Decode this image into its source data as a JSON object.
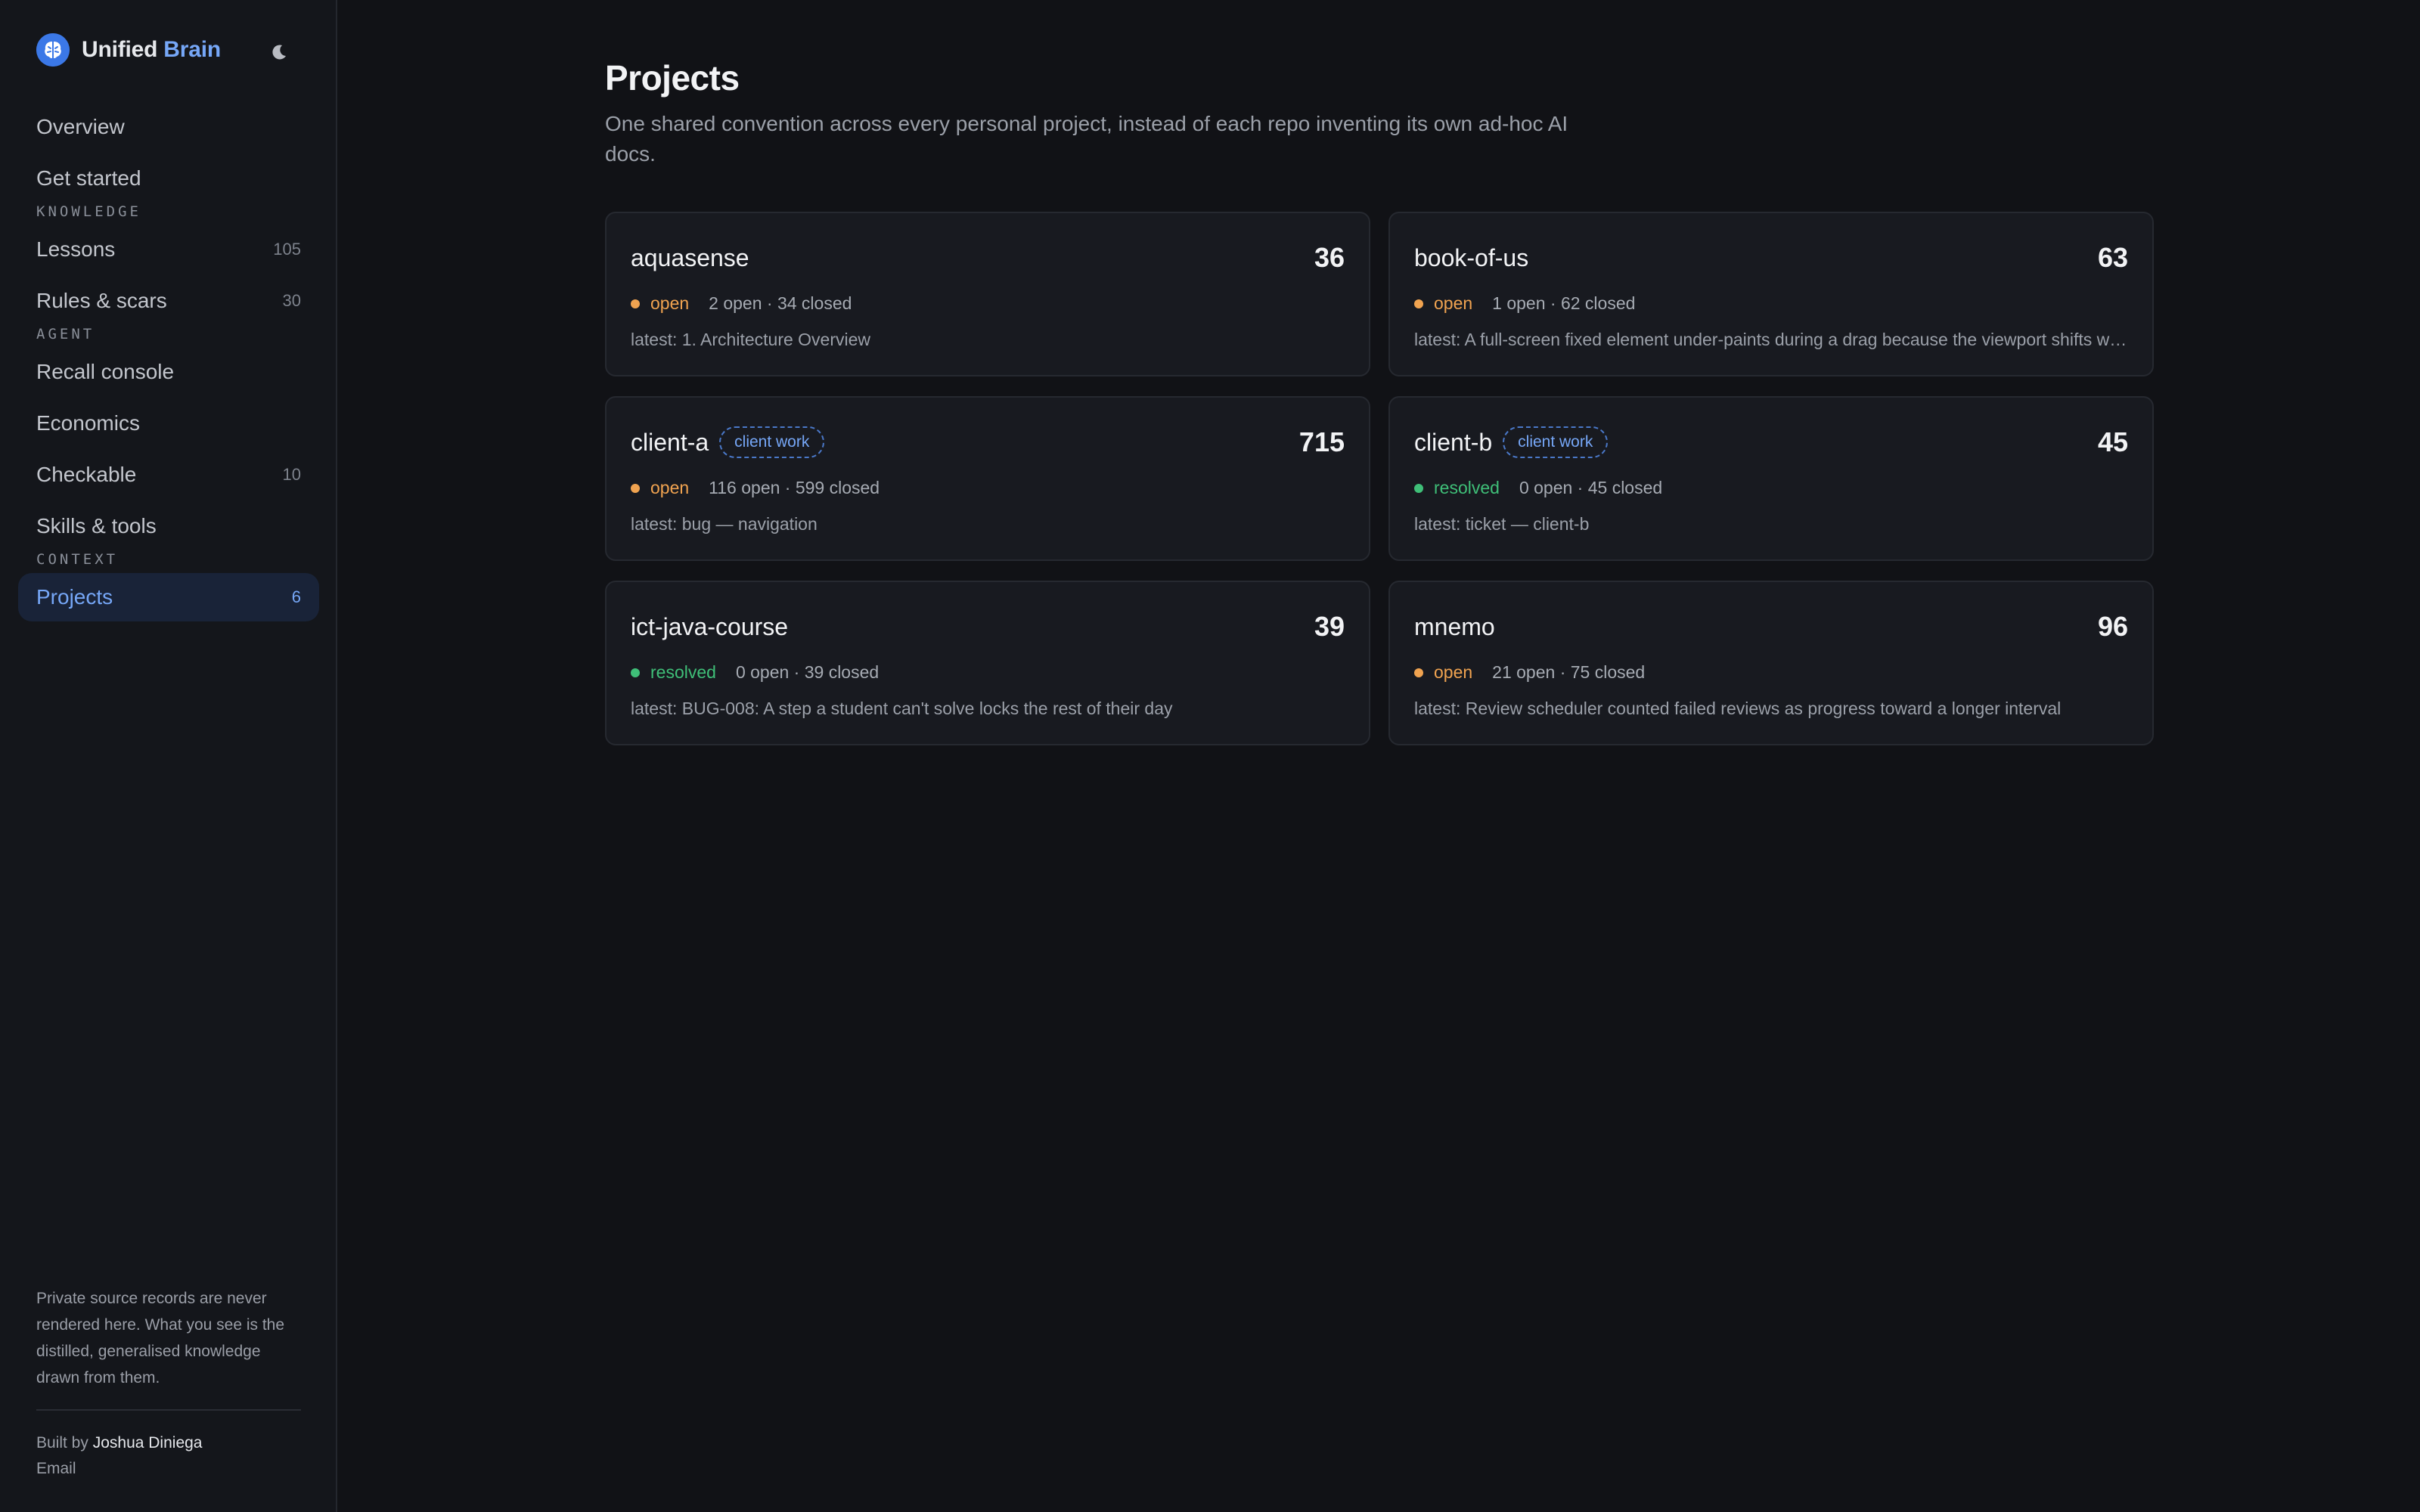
{
  "brand": {
    "name": "Unified",
    "accent": "Brain"
  },
  "sidebar": {
    "nav": [
      {
        "type": "item",
        "name": "nav-overview",
        "label": "Overview",
        "count": ""
      },
      {
        "type": "item",
        "name": "nav-get-started",
        "label": "Get started",
        "count": ""
      },
      {
        "type": "section",
        "label": "KNOWLEDGE"
      },
      {
        "type": "item",
        "name": "nav-lessons",
        "label": "Lessons",
        "count": "105"
      },
      {
        "type": "item",
        "name": "nav-rules-scars",
        "label": "Rules & scars",
        "count": "30"
      },
      {
        "type": "section",
        "label": "AGENT"
      },
      {
        "type": "item",
        "name": "nav-recall-console",
        "label": "Recall console",
        "count": ""
      },
      {
        "type": "item",
        "name": "nav-economics",
        "label": "Economics",
        "count": ""
      },
      {
        "type": "item",
        "name": "nav-checkable",
        "label": "Checkable",
        "count": "10"
      },
      {
        "type": "item",
        "name": "nav-skills-tools",
        "label": "Skills & tools",
        "count": ""
      },
      {
        "type": "section",
        "label": "CONTEXT"
      },
      {
        "type": "item",
        "name": "nav-projects",
        "label": "Projects",
        "count": "6",
        "active": true
      }
    ],
    "footer": {
      "note": "Private source records are never rendered here. What you see is the distilled, generalised knowledge drawn from them.",
      "built_by_prefix": "Built by",
      "author": "Joshua Diniega",
      "email": "Email"
    }
  },
  "page": {
    "title": "Projects",
    "subtitle": "One shared convention across every personal project, instead of each repo inventing its own ad-hoc AI docs."
  },
  "projects": [
    {
      "name": "aquasense",
      "tag": "",
      "total": "36",
      "status": "open",
      "counts": "2 open · 34 closed",
      "latest": "latest: 1. Architecture Overview"
    },
    {
      "name": "book-of-us",
      "tag": "",
      "total": "63",
      "status": "open",
      "counts": "1 open · 62 closed",
      "latest": "latest: A full-screen fixed element under-paints during a drag because the viewport shifts while the page scrolls"
    },
    {
      "name": "client-a",
      "tag": "client work",
      "total": "715",
      "status": "open",
      "counts": "116 open · 599 closed",
      "latest": "latest: bug — navigation"
    },
    {
      "name": "client-b",
      "tag": "client work",
      "total": "45",
      "status": "resolved",
      "counts": "0 open · 45 closed",
      "latest": "latest: ticket — client-b"
    },
    {
      "name": "ict-java-course",
      "tag": "",
      "total": "39",
      "status": "resolved",
      "counts": "0 open · 39 closed",
      "latest": "latest: BUG-008: A step a student can't solve locks the rest of their day"
    },
    {
      "name": "mnemo",
      "tag": "",
      "total": "96",
      "status": "open",
      "counts": "21 open · 75 closed",
      "latest": "latest: Review scheduler counted failed reviews as progress toward a longer interval"
    }
  ],
  "colors": {
    "accent": "#76a7f7",
    "open": "#f0a350",
    "resolved": "#3fbf78",
    "background": "#111216"
  }
}
